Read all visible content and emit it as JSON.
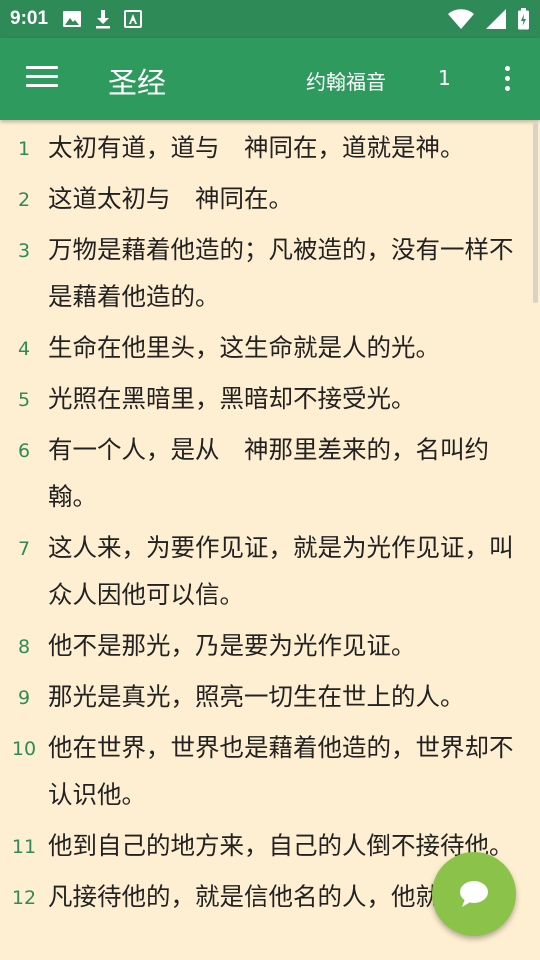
{
  "status_bar": {
    "time": "9:01",
    "icons": [
      "image-icon",
      "download-icon",
      "font-icon",
      "wifi-icon",
      "signal-icon",
      "battery-icon"
    ]
  },
  "toolbar": {
    "title": "圣经",
    "book": "约翰福音",
    "chapter": "1"
  },
  "colors": {
    "primary": "#2E9A5E",
    "background": "#FFEFD2",
    "verse_number": "#2E8B57",
    "fab": "#8BC34A"
  },
  "verses": [
    {
      "num": "1",
      "text": "太初有道，道与　神同在，道就是神。"
    },
    {
      "num": "2",
      "text": "这道太初与　神同在。"
    },
    {
      "num": "3",
      "text": "万物是藉着他造的；凡被造的，没有一样不是藉着他造的。"
    },
    {
      "num": "4",
      "text": "生命在他里头，这生命就是人的光。"
    },
    {
      "num": "5",
      "text": "光照在黑暗里，黑暗却不接受光。"
    },
    {
      "num": "6",
      "text": "有一个人，是从　神那里差来的，名叫约翰。"
    },
    {
      "num": "7",
      "text": "这人来，为要作见证，就是为光作见证，叫众人因他可以信。"
    },
    {
      "num": "8",
      "text": "他不是那光，乃是要为光作见证。"
    },
    {
      "num": "9",
      "text": "那光是真光，照亮一切生在世上的人。"
    },
    {
      "num": "10",
      "text": "他在世界，世界也是藉着他造的，世界却不认识他。"
    },
    {
      "num": "11",
      "text": "他到自己的地方来，自己的人倒不接待他。"
    },
    {
      "num": "12",
      "text": "凡接待他的，就是信他名的人，他就赐"
    }
  ]
}
